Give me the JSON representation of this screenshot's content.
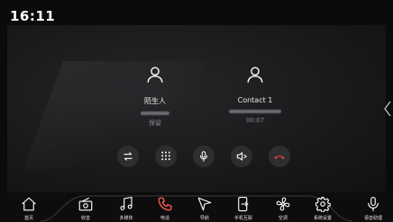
{
  "status_bar": {
    "time": "16:11"
  },
  "call": {
    "contacts": [
      {
        "name": "陌生人",
        "status": "保留",
        "avatar_icon": "person-icon"
      },
      {
        "name": "Contact 1",
        "status": "00:07",
        "avatar_icon": "person-icon"
      }
    ],
    "controls": [
      {
        "icon": "swap-calls-icon"
      },
      {
        "icon": "dialpad-icon"
      },
      {
        "icon": "microphone-icon"
      },
      {
        "icon": "speaker-icon"
      },
      {
        "icon": "hang-up-icon",
        "color": "#e0453d"
      }
    ]
  },
  "dock": {
    "items": [
      {
        "label": "首页",
        "icon": "home-icon"
      },
      {
        "label": "收音",
        "icon": "radio-icon"
      },
      {
        "label": "多媒体",
        "icon": "music-note-icon"
      },
      {
        "label": "电话",
        "icon": "phone-icon"
      },
      {
        "label": "导航",
        "icon": "navigation-icon"
      },
      {
        "label": "手机互联",
        "icon": "phone-link-icon"
      },
      {
        "label": "空调",
        "icon": "fan-icon"
      },
      {
        "label": "系统设置",
        "icon": "gear-icon"
      },
      {
        "label": "语音助理",
        "icon": "voice-assistant-icon"
      }
    ],
    "active_color": "#ff5a4e"
  }
}
